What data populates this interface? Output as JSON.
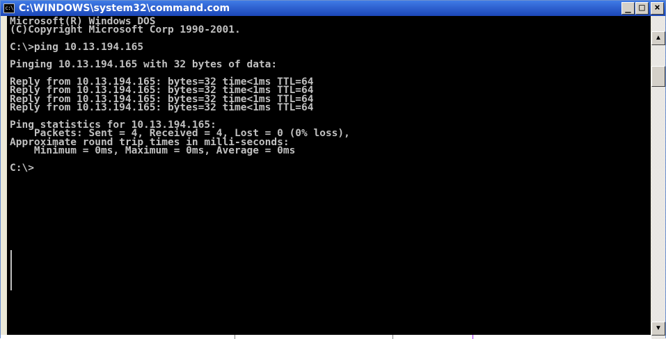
{
  "window": {
    "title": "C:\\WINDOWS\\system32\\command.com",
    "icon_text": "c:\\",
    "controls": {
      "minimize": "_",
      "maximize": "□",
      "close": "×"
    }
  },
  "console": {
    "text": "Microsoft(R) Windows DOS\n(C)Copyright Microsoft Corp 1990-2001.\n\nC:\\>ping 10.13.194.165\n\nPinging 10.13.194.165 with 32 bytes of data:\n\nReply from 10.13.194.165: bytes=32 time<1ms TTL=64\nReply from 10.13.194.165: bytes=32 time<1ms TTL=64\nReply from 10.13.194.165: bytes=32 time<1ms TTL=64\nReply from 10.13.194.165: bytes=32 time<1ms TTL=64\n\nPing statistics for 10.13.194.165:\n    Packets: Sent = 4, Received = 4, Lost = 0 (0% loss),\nApproximate round trip times in milli-seconds:\n    Minimum = 0ms, Maximum = 0ms, Average = 0ms\n\nC:\\>",
    "text_color": "#c0c0c0",
    "background": "#000000"
  },
  "scrollbar": {
    "up_arrow": "▲",
    "down_arrow": "▼"
  }
}
